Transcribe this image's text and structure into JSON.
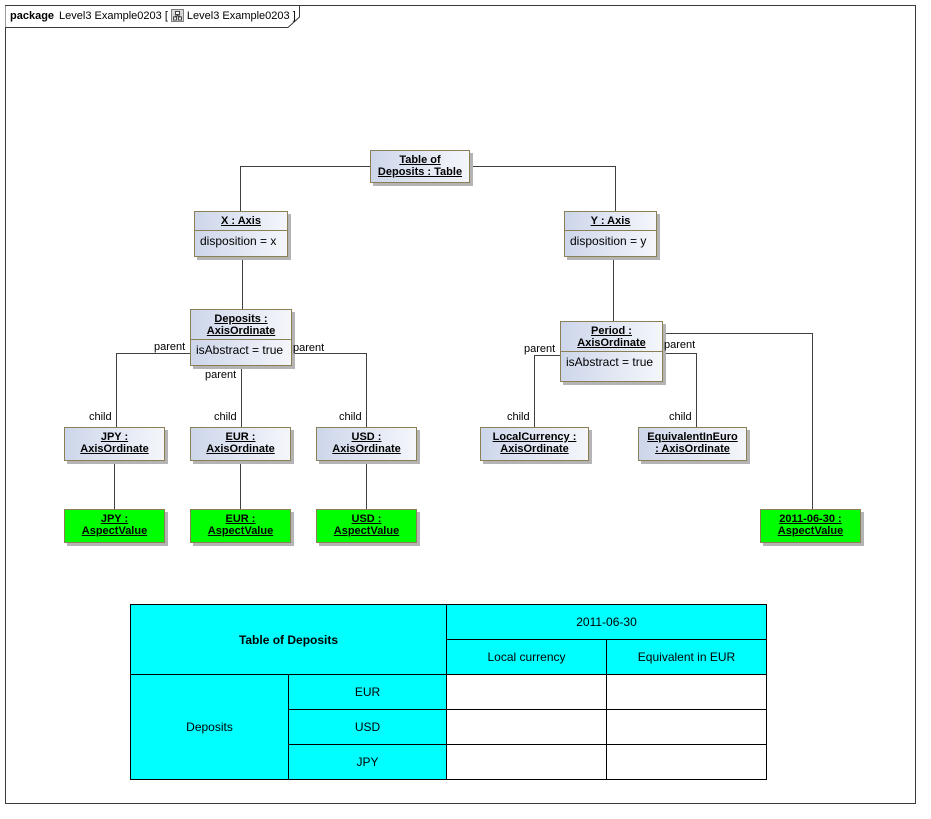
{
  "frame": {
    "keyword": "package",
    "name": "Level3 Example0203",
    "diagram_icon": "class-diagram-icon",
    "diagram_name": "Level3 Example0203"
  },
  "nodes": {
    "table": {
      "title_line1": "Table of",
      "title_line2": "Deposits : Table"
    },
    "x_axis": {
      "title": "X : Axis",
      "attr": "disposition = x"
    },
    "y_axis": {
      "title": "Y : Axis",
      "attr": "disposition = y"
    },
    "deposits": {
      "title_line1": "Deposits :",
      "title_line2": "AxisOrdinate",
      "attr": "isAbstract = true"
    },
    "period": {
      "title_line1": "Period :",
      "title_line2": "AxisOrdinate",
      "attr": "isAbstract = true"
    },
    "jpy": {
      "title_line1": "JPY :",
      "title_line2": "AxisOrdinate"
    },
    "eur": {
      "title_line1": "EUR :",
      "title_line2": "AxisOrdinate"
    },
    "usd": {
      "title_line1": "USD :",
      "title_line2": "AxisOrdinate"
    },
    "local_currency": {
      "title_line1": "LocalCurrency :",
      "title_line2": "AxisOrdinate"
    },
    "equivalent_in_euro": {
      "title_line1": "EquivalentInEuro",
      "title_line2": ": AxisOrdinate"
    },
    "jpy_value": {
      "title_line1": "JPY :",
      "title_line2": "AspectValue"
    },
    "eur_value": {
      "title_line1": "EUR :",
      "title_line2": "AspectValue"
    },
    "usd_value": {
      "title_line1": "USD :",
      "title_line2": "AspectValue"
    },
    "date_value": {
      "title_line1": "2011-06-30 :",
      "title_line2": "AspectValue"
    }
  },
  "role_labels": {
    "parent": "parent",
    "child": "child"
  },
  "colors": {
    "aspect_value_fill": "#00ff00",
    "table_header_fill": "#00ffff",
    "node_border": "#8b7f55"
  },
  "table": {
    "title": "Table of Deposits",
    "period_header": "2011-06-30",
    "column_headers": [
      "Local currency",
      "Equivalent in EUR"
    ],
    "row_group": "Deposits",
    "rows": [
      {
        "label": "EUR",
        "cells": [
          "",
          ""
        ]
      },
      {
        "label": "USD",
        "cells": [
          "",
          ""
        ]
      },
      {
        "label": "JPY",
        "cells": [
          "",
          ""
        ]
      }
    ]
  }
}
